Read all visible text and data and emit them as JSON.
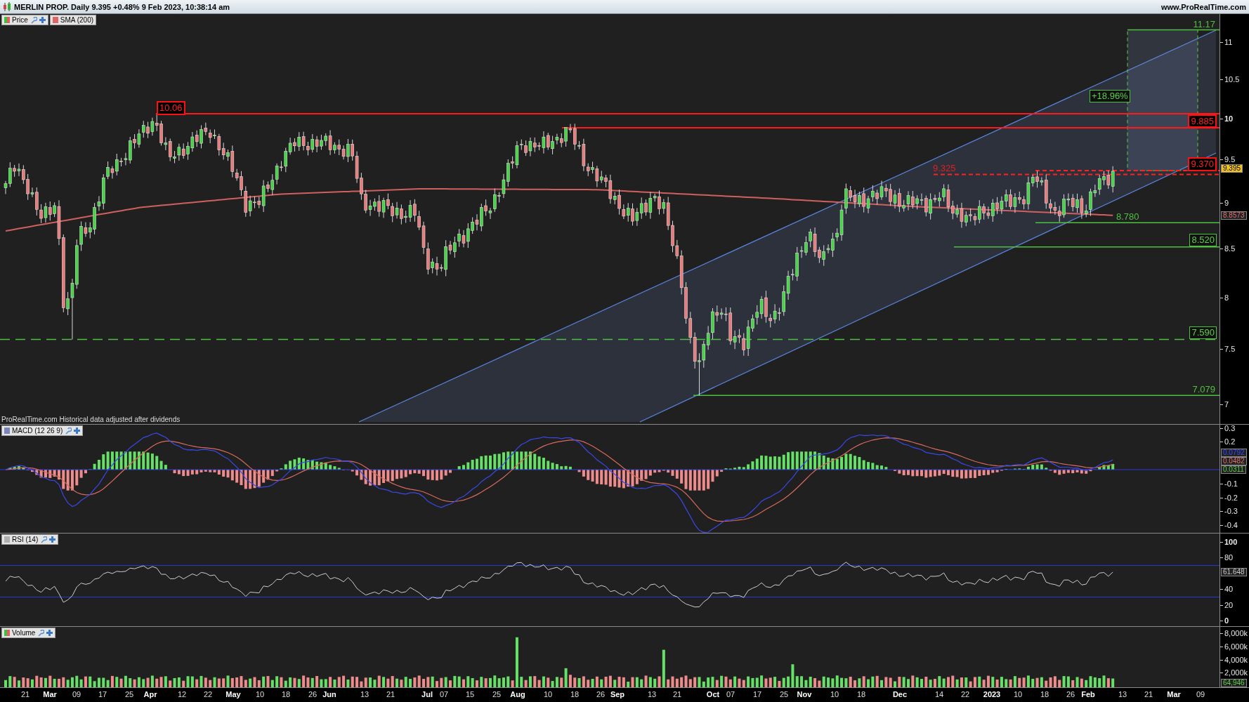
{
  "title_bar": {
    "title": "MERLIN PROP. Daily 9.395 +0.48% 9 Feb 2023, 10:38:14 am",
    "website": "www.ProRealTime.com"
  },
  "price_panel": {
    "legend": [
      {
        "label": "Price",
        "kind": "split",
        "tools": true
      },
      {
        "label": "SMA (200)",
        "kind": "solid",
        "color": "#e06666",
        "tools": false
      }
    ],
    "note": "ProRealTime.com  Historical data adjusted after dividends",
    "annotations": [
      {
        "kind": "red-box",
        "label": "10.06"
      },
      {
        "kind": "red-box",
        "label": "9.885"
      },
      {
        "kind": "red-box",
        "label": "9.370"
      },
      {
        "kind": "red-text",
        "label": "9.325"
      },
      {
        "kind": "green-text",
        "label": "11.17"
      },
      {
        "kind": "green-box",
        "label": "+18.96%"
      },
      {
        "kind": "green-text",
        "label": "8.780"
      },
      {
        "kind": "green-box",
        "label": "8.520"
      },
      {
        "kind": "green-box",
        "label": "7.590"
      },
      {
        "kind": "green-text",
        "label": "7.079"
      }
    ],
    "axis_labels": [
      {
        "label": "11",
        "bold": false
      },
      {
        "label": "10.5",
        "bold": false
      },
      {
        "label": "10",
        "bold": true
      },
      {
        "label": "9.5",
        "bold": false
      },
      {
        "label": "9",
        "bold": false
      },
      {
        "label": "8.5",
        "bold": false
      },
      {
        "label": "8",
        "bold": false
      },
      {
        "label": "7.5",
        "bold": false
      },
      {
        "label": "7",
        "bold": false
      }
    ],
    "axis_tags": [
      {
        "kind": "last-price",
        "label": "9.395"
      },
      {
        "kind": "sma",
        "label": "8.8573"
      }
    ]
  },
  "macd_panel": {
    "legend": [
      {
        "label": "MACD (12 26 9)",
        "kind": "solid",
        "color": "#7a86b8",
        "tools": true
      }
    ],
    "axis_labels": [
      {
        "label": "0.3",
        "bold": false
      },
      {
        "label": "0.2",
        "bold": false
      },
      {
        "label": "-0.1",
        "bold": false
      },
      {
        "label": "-0.2",
        "bold": false
      },
      {
        "label": "-0.3",
        "bold": false
      },
      {
        "label": "-0.4",
        "bold": false
      }
    ],
    "axis_tags": [
      {
        "kind": "macd",
        "label": "0.0792"
      },
      {
        "kind": "signal",
        "label": "0.0482"
      },
      {
        "kind": "histogram",
        "label": "0.0311"
      }
    ]
  },
  "rsi_panel": {
    "legend": [
      {
        "label": "RSI (14)",
        "kind": "solid",
        "color": "#b0b0b0",
        "tools": true
      }
    ],
    "axis_labels": [
      {
        "label": "100",
        "bold": true
      },
      {
        "label": "80",
        "bold": false
      },
      {
        "label": "40",
        "bold": false
      },
      {
        "label": "20",
        "bold": false
      },
      {
        "label": "0",
        "bold": true
      }
    ],
    "axis_tags": [
      {
        "kind": "rsi",
        "label": "61.648"
      }
    ]
  },
  "volume_panel": {
    "legend": [
      {
        "label": "Volume",
        "kind": "split",
        "tools": true
      }
    ],
    "axis_labels": [
      {
        "label": "8,000k",
        "bold": false
      },
      {
        "label": "6,000k",
        "bold": false
      },
      {
        "label": "4,000k",
        "bold": false
      },
      {
        "label": "2,000k",
        "bold": false
      }
    ],
    "axis_tags": [
      {
        "kind": "volume",
        "label": "64,946"
      }
    ]
  },
  "date_axis": [
    {
      "label": "21",
      "bold": false
    },
    {
      "label": "Mar",
      "bold": true
    },
    {
      "label": "09",
      "bold": false
    },
    {
      "label": "17",
      "bold": false
    },
    {
      "label": "25",
      "bold": false
    },
    {
      "label": "Apr",
      "bold": true
    },
    {
      "label": "12",
      "bold": false
    },
    {
      "label": "22",
      "bold": false
    },
    {
      "label": "May",
      "bold": true
    },
    {
      "label": "10",
      "bold": false
    },
    {
      "label": "18",
      "bold": false
    },
    {
      "label": "26",
      "bold": false
    },
    {
      "label": "Jun",
      "bold": true
    },
    {
      "label": "13",
      "bold": false
    },
    {
      "label": "21",
      "bold": false
    },
    {
      "label": "Jul",
      "bold": true
    },
    {
      "label": "07",
      "bold": false
    },
    {
      "label": "15",
      "bold": false
    },
    {
      "label": "25",
      "bold": false
    },
    {
      "label": "Aug",
      "bold": true
    },
    {
      "label": "10",
      "bold": false
    },
    {
      "label": "18",
      "bold": false
    },
    {
      "label": "26",
      "bold": false
    },
    {
      "label": "Sep",
      "bold": true
    },
    {
      "label": "13",
      "bold": false
    },
    {
      "label": "21",
      "bold": false
    },
    {
      "label": "Oct",
      "bold": true
    },
    {
      "label": "07",
      "bold": false
    },
    {
      "label": "17",
      "bold": false
    },
    {
      "label": "25",
      "bold": false
    },
    {
      "label": "Nov",
      "bold": true
    },
    {
      "label": "10",
      "bold": false
    },
    {
      "label": "18",
      "bold": false
    },
    {
      "label": "Dec",
      "bold": true
    },
    {
      "label": "14",
      "bold": false
    },
    {
      "label": "22",
      "bold": false
    },
    {
      "label": "2023",
      "bold": true
    },
    {
      "label": "10",
      "bold": false
    },
    {
      "label": "18",
      "bold": false
    },
    {
      "label": "26",
      "bold": false
    },
    {
      "label": "Feb",
      "bold": true
    },
    {
      "label": "13",
      "bold": false
    },
    {
      "label": "21",
      "bold": false
    },
    {
      "label": "Mar",
      "bold": true
    },
    {
      "label": "09",
      "bold": false
    }
  ]
}
